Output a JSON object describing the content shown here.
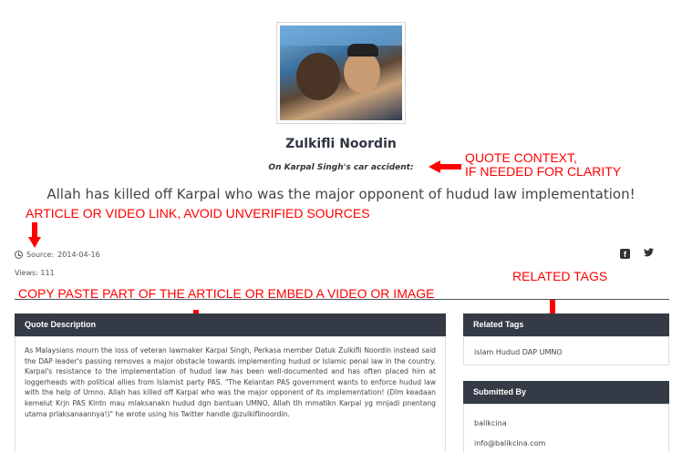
{
  "quote": {
    "author": "Zulkifli Noordin",
    "context": "On Karpal Singh's car accident:",
    "text": "Allah has killed off Karpal who was the major opponent of hudud law implementation!",
    "source_label": "Source:",
    "source_date": "2014-04-16",
    "views_label": "Views:",
    "views_count": "111"
  },
  "social": {
    "facebook_icon": "facebook-icon",
    "twitter_icon": "twitter-icon"
  },
  "annotations": {
    "context_line1": "QUOTE CONTEXT,",
    "context_line2": "IF NEEDED FOR CLARITY",
    "link": "ARTICLE OR VIDEO LINK, AVOID UNVERIFIED SOURCES",
    "tags": "RELATED TAGS",
    "copy": "COPY PASTE PART OF THE ARTICLE OR EMBED A VIDEO OR IMAGE",
    "color": "#ff0000"
  },
  "description": {
    "heading": "Quote Description",
    "body": "As Malaysians mourn the loss of veteran lawmaker Karpal Singh, Perkasa member Datuk Zulkifli Noordin instead said the DAP leader's passing removes a major obstacle towards implementing hudud or Islamic penal law in the country. Karpal's resistance to the implementation of hudud law has been well-documented and has often placed him at loggerheads with political allies from Islamist party PAS. \"The Kelantan PAS government wants to enforce hudud law with the help of Umno. Allah has killed off Karpal who was the major opponent of its implementation! (Dlm keadaan kemelut Krjn PAS Klntn mau mlaksanakn hudud dgn bantuan UMNO, Allah tlh mmatikn Karpal yg mnjadi pnentang utama prlaksanaannya!)\" he wrote using his Twitter handle @zulkiflinoordin."
  },
  "related_tags": {
    "heading": "Related Tags",
    "tags": [
      "islam",
      "Hudud",
      "DAP",
      "UMNO"
    ]
  },
  "submitted_by": {
    "heading": "Submitted By",
    "user": "balikcina",
    "email": "info@balikcina.com"
  },
  "colors": {
    "panel_header": "#343a46",
    "arrow": "#ff0000"
  }
}
